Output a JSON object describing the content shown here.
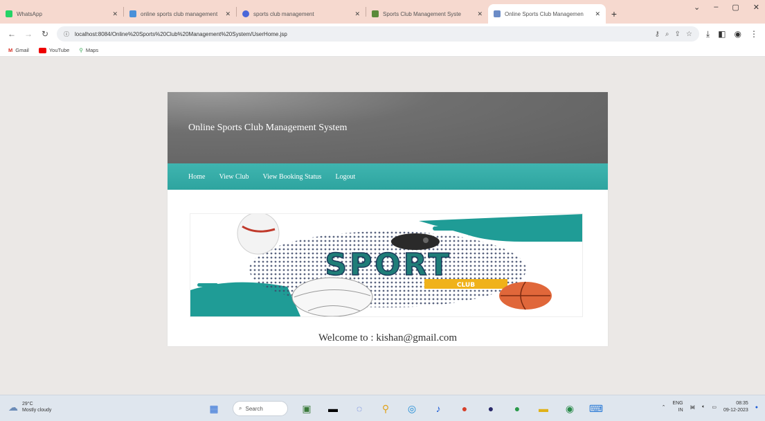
{
  "browser": {
    "tabs": [
      {
        "title": "WhatsApp",
        "color": "#25d366",
        "active": false
      },
      {
        "title": "online sports club management",
        "color": "#4a90d9",
        "active": false
      },
      {
        "title": "sports club management",
        "color": "#4a67d9",
        "active": false
      },
      {
        "title": "Sports Club Management Syste",
        "color": "#5a8a3a",
        "active": false
      },
      {
        "title": "Online Sports Club Managemen",
        "color": "#6b8cc7",
        "active": true
      }
    ],
    "url": "localhost:8084/Online%20Sports%20Club%20Management%20System/UserHome.jsp",
    "bookmarks": [
      "Gmail",
      "YouTube",
      "Maps"
    ]
  },
  "site": {
    "title": "Online Sports Club Management System",
    "nav": [
      "Home",
      "View Club",
      "View Booking Status",
      "Logout"
    ],
    "banner_word": "SPORT",
    "banner_sub": "CLUB",
    "welcome": "Welcome to : kishan@gmail.com"
  },
  "taskbar": {
    "temp": "29°C",
    "condition": "Mostly cloudy",
    "search_placeholder": "Search",
    "lang_top": "ENG",
    "lang_bottom": "IN",
    "time": "08:35",
    "date": "09-12-2023"
  },
  "colors": {
    "header_gray": "#6f6f6f",
    "nav_teal": "#34aba6",
    "tabstrip": "#f6d9cf",
    "teal_accent": "#1f9c96",
    "ball_orange": "#e0673a"
  }
}
